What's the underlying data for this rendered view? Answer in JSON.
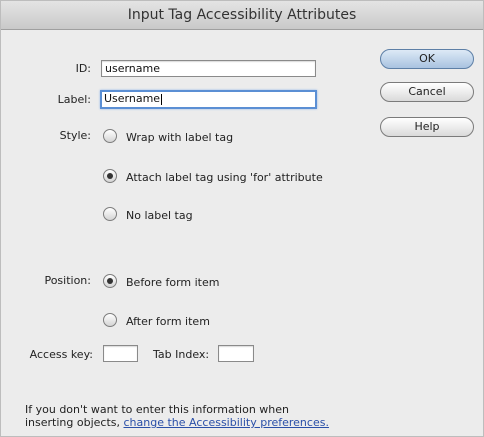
{
  "dialog": {
    "title": "Input Tag Accessibility Attributes"
  },
  "form": {
    "id_label": "ID:",
    "id_value": "username",
    "label_label": "Label:",
    "label_value": "Username",
    "style_label": "Style:",
    "style_options": [
      {
        "label": "Wrap with label tag",
        "selected": false
      },
      {
        "label": "Attach label tag using 'for' attribute",
        "selected": true
      },
      {
        "label": "No label tag",
        "selected": false
      }
    ],
    "position_label": "Position:",
    "position_options": [
      {
        "label": "Before form item",
        "selected": true
      },
      {
        "label": "After form item",
        "selected": false
      }
    ],
    "access_key_label": "Access key:",
    "access_key_value": "",
    "tab_index_label": "Tab Index:",
    "tab_index_value": ""
  },
  "buttons": {
    "ok": "OK",
    "cancel": "Cancel",
    "help": "Help"
  },
  "footer": {
    "line1": "If you don't want to enter this information when",
    "line2_prefix": "inserting objects,",
    "link": "change the Accessibility preferences."
  },
  "colors": {
    "default_button": "#a9c3e0",
    "link": "#2a4fa8",
    "focus_ring": "#5b8fd4"
  }
}
